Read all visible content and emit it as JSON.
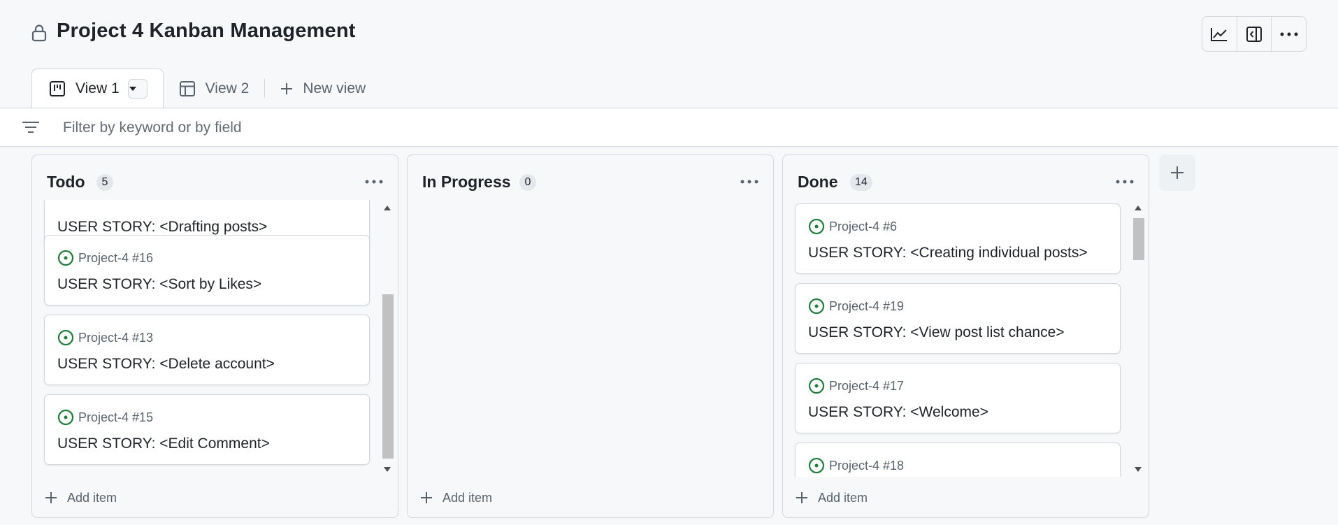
{
  "header": {
    "title": "Project 4 Kanban Management",
    "toolbar": [
      "insights-icon",
      "side-panel-icon",
      "kebab-icon"
    ]
  },
  "tabs": [
    {
      "label": "View 1",
      "icon": "board-icon",
      "active": true
    },
    {
      "label": "View 2",
      "icon": "table-icon",
      "active": false
    },
    {
      "label": "New view",
      "icon": "plus-icon",
      "active": false
    }
  ],
  "filter": {
    "placeholder": "Filter by keyword or by field"
  },
  "columns": [
    {
      "title": "Todo",
      "count": "5",
      "add_label": "Add item",
      "cards": [
        {
          "ref": "",
          "title": "USER STORY: <Drafting posts>"
        },
        {
          "ref": "Project-4 #16",
          "title": "USER STORY: <Sort by Likes>"
        },
        {
          "ref": "Project-4 #13",
          "title": "USER STORY: <Delete account>"
        },
        {
          "ref": "Project-4 #15",
          "title": "USER STORY: <Edit Comment>"
        }
      ]
    },
    {
      "title": "In Progress",
      "count": "0",
      "add_label": "Add item",
      "cards": []
    },
    {
      "title": "Done",
      "count": "14",
      "add_label": "Add item",
      "cards": [
        {
          "ref": "Project-4 #6",
          "title": "USER STORY: <Creating individual posts>"
        },
        {
          "ref": "Project-4 #19",
          "title": "USER STORY: <View post list chance>"
        },
        {
          "ref": "Project-4 #17",
          "title": "USER STORY: <Welcome>"
        },
        {
          "ref": "Project-4 #18",
          "title": ""
        }
      ]
    }
  ],
  "colors": {
    "open_issue": "#1a7f37",
    "border": "#d0d7de",
    "background": "#f6f8fa",
    "text_muted": "#59636e"
  }
}
